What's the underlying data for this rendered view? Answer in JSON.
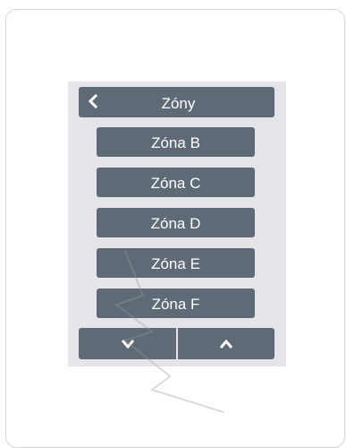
{
  "header": {
    "title": "Zóny",
    "back_icon": "chevron-left-icon"
  },
  "zones": [
    "Zóna B",
    "Zóna C",
    "Zóna D",
    "Zóna E",
    "Zóna F"
  ],
  "navigation": {
    "down_icon": "chevron-down-icon",
    "up_icon": "chevron-up-icon"
  },
  "colors": {
    "button": "#5e6b77",
    "panel": "#e5e5e9",
    "text": "#ffffff"
  }
}
